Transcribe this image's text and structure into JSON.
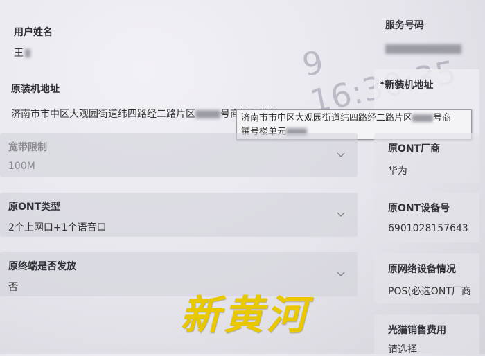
{
  "user": {
    "name_label": "用户姓名",
    "name_value": "王"
  },
  "service": {
    "label": "服务号码"
  },
  "timestamp_overlay": "9 16:30:35",
  "original_address": {
    "label": "原装机地址",
    "value_prefix": "济南市市中区大观园街道纬四路经二路片区",
    "value_suffix": "号商铺号楼单元用..."
  },
  "new_address": {
    "label": "*新装机地址"
  },
  "tooltip": {
    "line1_prefix": "济南市市中区大观园街道纬四路经二路片区",
    "line1_suffix": "号商",
    "line2": "铺号楼单元"
  },
  "fields_left": [
    {
      "label": "宽带限制",
      "value": "100M"
    },
    {
      "label": "原ONT类型",
      "value": "2个上网口+1个语音口"
    },
    {
      "label": "原终端是否发放",
      "value": "否"
    }
  ],
  "fields_right": [
    {
      "label": "原ONT厂商",
      "value": "华为"
    },
    {
      "label": "原ONT设备号",
      "value": "6901028157643"
    },
    {
      "label": "原网络设备情况",
      "value": "POS(必选ONT厂商"
    },
    {
      "label": "光猫销售费用",
      "value": "请选择"
    }
  ],
  "watermark": "新黄河"
}
